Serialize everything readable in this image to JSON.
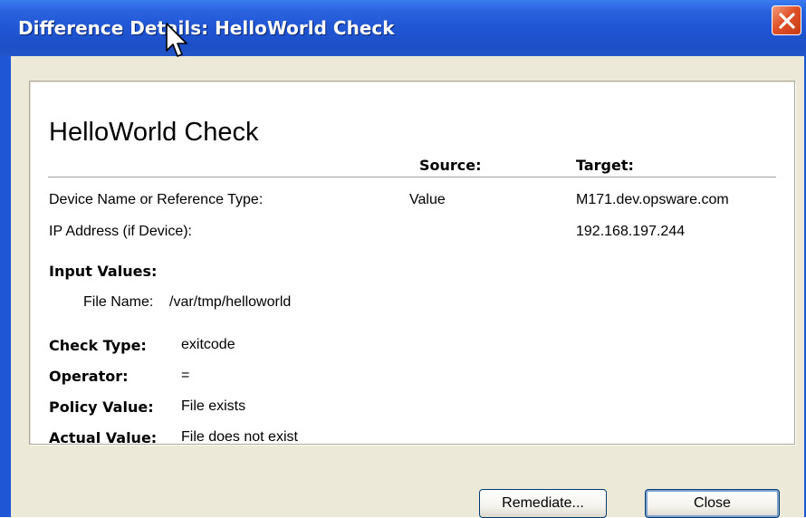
{
  "window": {
    "title": "Difference Details: HelloWorld Check",
    "close_icon": "close-icon"
  },
  "panel": {
    "heading": "HelloWorld Check",
    "columns": {
      "source": "Source:",
      "target": "Target:"
    },
    "rows": [
      {
        "label": "Device Name or Reference Type:",
        "source": "Value",
        "target": "M171.dev.opsware.com"
      },
      {
        "label": "IP Address (if Device):",
        "source": "",
        "target": "192.168.197.244"
      }
    ],
    "input_values": {
      "heading": "Input Values:",
      "file_name_label": "File Name:",
      "file_name_value": "/var/tmp/helloworld"
    },
    "details": [
      {
        "label": "Check Type:",
        "value": "exitcode"
      },
      {
        "label": "Operator:",
        "value": "="
      },
      {
        "label": "Policy Value:",
        "value": "File exists"
      },
      {
        "label": "Actual Value:",
        "value": "File does not exist"
      }
    ]
  },
  "buttons": {
    "remediate": "Remediate...",
    "close": "Close"
  },
  "colors": {
    "titlebar": "#1f54d2",
    "dialog_background": "#ece9d8",
    "close_button": "#e0532a"
  }
}
